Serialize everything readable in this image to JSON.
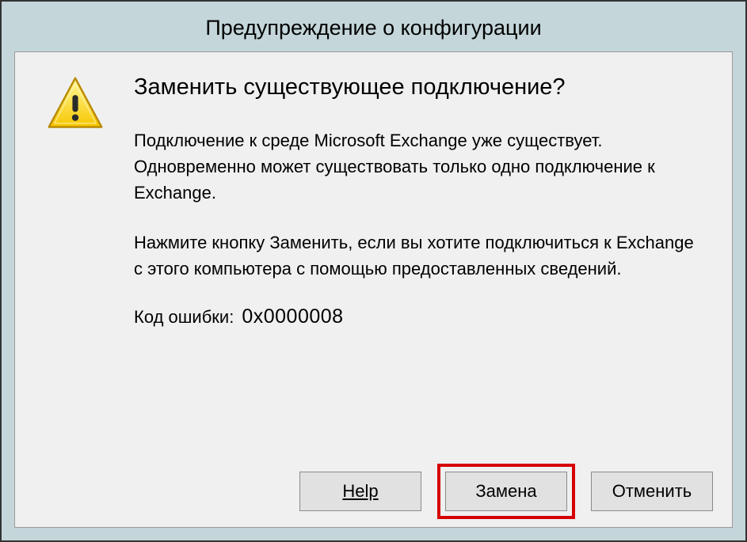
{
  "dialog": {
    "title": "Предупреждение о конфигурации",
    "heading": "Заменить существующее подключение?",
    "paragraph1": "Подключение к среде Microsoft Exchange уже существует. Одновременно может существовать только одно подключение к Exchange.",
    "paragraph2": "Нажмите кнопку Заменить, если вы хотите подключиться к Exchange с этого компьютера с помощью предоставленных сведений.",
    "error_label": "Код ошибки:",
    "error_code": "0x0000008"
  },
  "buttons": {
    "help": "Help",
    "replace": "Замена",
    "cancel": "Отменить"
  },
  "icons": {
    "warning": "warning-triangle"
  }
}
